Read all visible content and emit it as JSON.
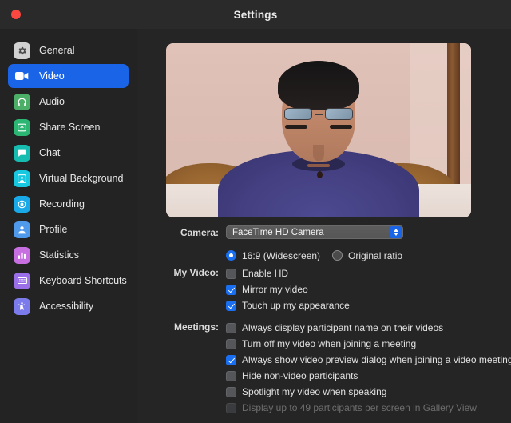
{
  "window": {
    "title": "Settings",
    "close_button": "close"
  },
  "sidebar": {
    "items": [
      {
        "label": "General",
        "icon": "gear-icon",
        "color": "#d2d2d2",
        "active": false
      },
      {
        "label": "Video",
        "icon": "video-camera-icon",
        "color": "#1a64e8",
        "active": true
      },
      {
        "label": "Audio",
        "icon": "headphones-icon",
        "color": "#4caf68",
        "active": false
      },
      {
        "label": "Share Screen",
        "icon": "share-screen-icon",
        "color": "#2bb673",
        "active": false
      },
      {
        "label": "Chat",
        "icon": "chat-bubble-icon",
        "color": "#17bcb0",
        "active": false
      },
      {
        "label": "Virtual Background",
        "icon": "virtual-background-icon",
        "color": "#17c8e0",
        "active": false
      },
      {
        "label": "Recording",
        "icon": "record-icon",
        "color": "#19a9e8",
        "active": false
      },
      {
        "label": "Profile",
        "icon": "person-icon",
        "color": "#4f9aea",
        "active": false
      },
      {
        "label": "Statistics",
        "icon": "bar-chart-icon",
        "color": "#c76fe0",
        "active": false
      },
      {
        "label": "Keyboard Shortcuts",
        "icon": "keyboard-icon",
        "color": "#9b6fe8",
        "active": false
      },
      {
        "label": "Accessibility",
        "icon": "accessibility-icon",
        "color": "#7b7bec",
        "active": false
      }
    ]
  },
  "main": {
    "video_preview": {
      "alt": "self video preview of a person wearing glasses in front of a wall"
    },
    "camera": {
      "label": "Camera:",
      "selected": "FaceTime HD Camera"
    },
    "aspect_ratio": {
      "options": [
        {
          "label": "16:9 (Widescreen)",
          "selected": true
        },
        {
          "label": "Original ratio",
          "selected": false
        }
      ]
    },
    "my_video": {
      "label": "My Video:",
      "options": [
        {
          "label": "Enable HD",
          "checked": false,
          "disabled": false
        },
        {
          "label": "Mirror my video",
          "checked": true,
          "disabled": false
        },
        {
          "label": "Touch up my appearance",
          "checked": true,
          "disabled": false
        }
      ]
    },
    "meetings": {
      "label": "Meetings:",
      "options": [
        {
          "label": "Always display participant name on their videos",
          "checked": false,
          "disabled": false
        },
        {
          "label": "Turn off my video when joining a meeting",
          "checked": false,
          "disabled": false
        },
        {
          "label": "Always show video preview dialog when joining a video meeting",
          "checked": true,
          "disabled": false
        },
        {
          "label": "Hide non-video participants",
          "checked": false,
          "disabled": false
        },
        {
          "label": "Spotlight my video when speaking",
          "checked": false,
          "disabled": false
        },
        {
          "label": "Display up to 49 participants per screen in Gallery View",
          "checked": false,
          "disabled": true
        }
      ]
    }
  },
  "colors": {
    "accent": "#1a64e8",
    "checkbox_on": "#1a6ef0",
    "window_bg": "#252525",
    "sidebar_bg": "#232323",
    "titlebar_bg": "#2a2a2a",
    "close_red": "#f9483f"
  }
}
